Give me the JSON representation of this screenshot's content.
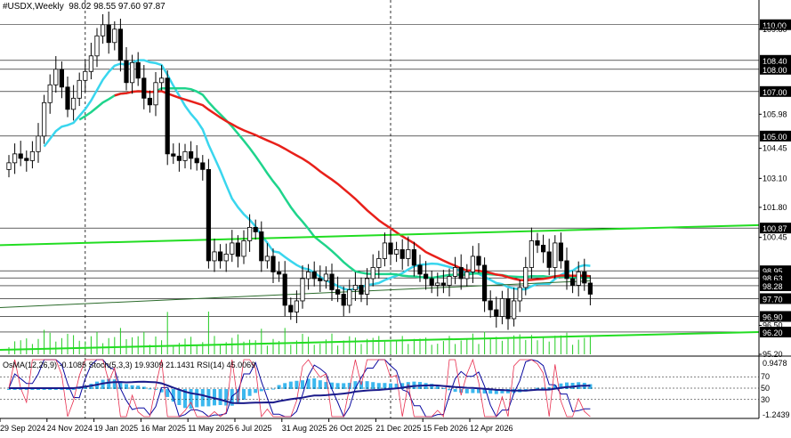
{
  "header": {
    "symbol": "#USDX,Weekly",
    "ohlc": "98.02 98.55 97.60 97.87"
  },
  "indicator_header": "OsMA(12,26,9) -0.1085  Stoch(5,3,3) 19.9309 21.1431  RSI(14) 45.0069",
  "colors": {
    "background": "#ffffff",
    "grid": "#000000",
    "candle_up": "#ffffff",
    "candle_down": "#000000",
    "ema_fast": "#3ad6ee",
    "ema_mid": "#1fd48c",
    "ema_slow": "#e8201a",
    "trend": "#22dd22",
    "volume": "#22cc22",
    "osma": "#3cb8ee",
    "stoch_main": "#0a0aa0",
    "stoch_signal": "#e83050",
    "rsi": "#1a1a8a"
  },
  "chart_data": {
    "type": "candlestick",
    "timeframe": "Weekly",
    "y_range": [
      95.2,
      110.55
    ],
    "price_levels": [
      "110.00",
      "108.40",
      "108.00",
      "107.00",
      "105.00",
      "100.87",
      "98.95",
      "98.63",
      "98.28",
      "97.70",
      "96.90",
      "96.20"
    ],
    "y_ticks": [
      "109.80",
      "105.98",
      "104.45",
      "103.10",
      "101.80",
      "100.45",
      "96.50",
      "95.20"
    ],
    "x_ticks": [
      "29 Sep 2024",
      "24 Nov 2024",
      "19 Jan 2025",
      "16 Mar 2025",
      "11 May 2025",
      "6 Jul 2025",
      "31 Aug 2025",
      "26 Oct 2025",
      "21 Dec 2025",
      "15 Feb 2026",
      "12 Apr 2026"
    ],
    "x_tick_index": [
      0,
      8,
      16,
      24,
      32,
      40,
      48,
      56,
      64,
      72,
      80
    ],
    "vlines_index": [
      13,
      65
    ],
    "closes": [
      103.8,
      104.2,
      104.0,
      103.9,
      104.3,
      105.0,
      106.5,
      107.3,
      108.0,
      107.2,
      106.2,
      106.7,
      107.5,
      107.9,
      108.6,
      109.5,
      110.0,
      109.2,
      109.8,
      108.4,
      107.4,
      108.3,
      107.6,
      106.7,
      106.4,
      107.4,
      107.6,
      104.2,
      104.1,
      103.9,
      104.3,
      104.0,
      103.8,
      103.5,
      99.4,
      99.8,
      99.4,
      99.7,
      100.2,
      99.6,
      100.3,
      100.9,
      100.7,
      99.4,
      99.6,
      98.9,
      98.8,
      97.4,
      97.1,
      97.6,
      98.6,
      98.9,
      98.6,
      98.5,
      98.8,
      98.1,
      97.9,
      97.4,
      98.1,
      98.3,
      97.9,
      98.6,
      99.1,
      99.5,
      100.2,
      99.7,
      99.9,
      99.5,
      99.9,
      99.2,
      98.8,
      98.6,
      98.3,
      98.4,
      98.3,
      98.7,
      99.1,
      98.6,
      98.9,
      99.6,
      99.2,
      97.6,
      97.2,
      96.9,
      97.7,
      96.8,
      97.6,
      98.2,
      99.1,
      100.3,
      100.1,
      99.8,
      99.1,
      100.2,
      99.4,
      98.6,
      98.3,
      98.9,
      98.4,
      97.9
    ],
    "osma_x_ticks": [
      "70",
      "50",
      "30"
    ],
    "osma_y_ticks": [
      "0.9478",
      "-1.2439"
    ]
  }
}
